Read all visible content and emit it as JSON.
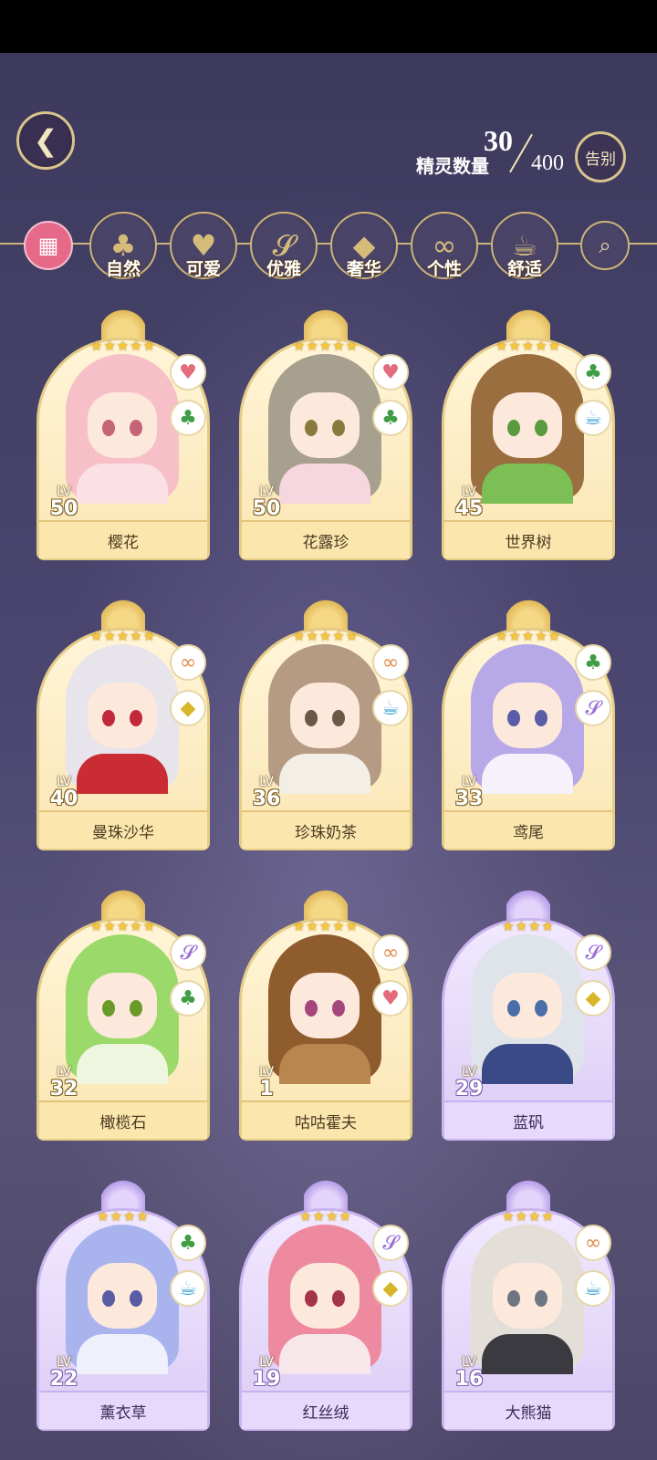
{
  "header": {
    "back_icon": "back-arrow-icon",
    "count_current": "30",
    "count_max": "400",
    "count_label": "精灵数量",
    "farewell_label": "告别"
  },
  "tabs": [
    {
      "label": "",
      "icon": "grid-icon"
    },
    {
      "label": "自然",
      "icon": "clover-icon"
    },
    {
      "label": "可爱",
      "icon": "heart-icon"
    },
    {
      "label": "优雅",
      "icon": "swan-icon"
    },
    {
      "label": "奢华",
      "icon": "diamond-icon"
    },
    {
      "label": "个性",
      "icon": "glasses-icon"
    },
    {
      "label": "舒适",
      "icon": "teacup-icon"
    },
    {
      "label": "",
      "icon": "search-icon"
    }
  ],
  "cards": [
    {
      "name": "樱花",
      "lv_label": "LV",
      "level": "50",
      "stars": "★★★★★",
      "badges": [
        "heart",
        "clover"
      ],
      "frame": "gold",
      "hair": "#f7c0c8",
      "eye": "#c46575",
      "outfit": "#fbe1e6"
    },
    {
      "name": "花露珍",
      "lv_label": "LV",
      "level": "50",
      "stars": "★★★★★",
      "badges": [
        "heart",
        "clover"
      ],
      "frame": "gold",
      "hair": "#a8a08e",
      "eye": "#8b7a3e",
      "outfit": "#f6d6df"
    },
    {
      "name": "世界树",
      "lv_label": "LV",
      "level": "45",
      "stars": "★★★★★",
      "badges": [
        "clover",
        "tea"
      ],
      "frame": "gold",
      "hair": "#9b6e3f",
      "eye": "#5b9a3e",
      "outfit": "#7bbf55"
    },
    {
      "name": "曼珠沙华",
      "lv_label": "LV",
      "level": "40",
      "stars": "★★★★★",
      "badges": [
        "glasses",
        "diamond"
      ],
      "frame": "gold",
      "hair": "#e8e4ec",
      "eye": "#c2283c",
      "outfit": "#c92c33"
    },
    {
      "name": "珍珠奶茶",
      "lv_label": "LV",
      "level": "36",
      "stars": "★★★★★",
      "badges": [
        "glasses",
        "tea"
      ],
      "frame": "gold",
      "hair": "#b59b83",
      "eye": "#6b5845",
      "outfit": "#f4efe6"
    },
    {
      "name": "鸢尾",
      "lv_label": "LV",
      "level": "33",
      "stars": "★★★★★",
      "badges": [
        "clover",
        "swan"
      ],
      "frame": "gold",
      "hair": "#b7a8e8",
      "eye": "#5b5ca8",
      "outfit": "#f5f2fb"
    },
    {
      "name": "橄榄石",
      "lv_label": "LV",
      "level": "32",
      "stars": "★★★★★",
      "badges": [
        "swan",
        "clover"
      ],
      "frame": "gold",
      "hair": "#9bd96b",
      "eye": "#6a9a2a",
      "outfit": "#eef6e0"
    },
    {
      "name": "咕咕霍夫",
      "lv_label": "LV",
      "level": "1",
      "stars": "★★★★★",
      "badges": [
        "glasses",
        "heart"
      ],
      "frame": "gold",
      "hair": "#8f5c2e",
      "eye": "#a4477c",
      "outfit": "#b8864e"
    },
    {
      "name": "蓝矾",
      "lv_label": "LV",
      "level": "29",
      "stars": "★★★★",
      "badges": [
        "swan",
        "diamond"
      ],
      "frame": "purple",
      "hair": "#dfe3ea",
      "eye": "#4a6ea8",
      "outfit": "#3a4a86"
    },
    {
      "name": "薰衣草",
      "lv_label": "LV",
      "level": "22",
      "stars": "★★★★",
      "badges": [
        "clover",
        "tea"
      ],
      "frame": "purple",
      "hair": "#a9b4ee",
      "eye": "#5a5ca6",
      "outfit": "#eef0fb"
    },
    {
      "name": "红丝绒",
      "lv_label": "LV",
      "level": "19",
      "stars": "★★★★",
      "badges": [
        "swan",
        "diamond"
      ],
      "frame": "purple",
      "hair": "#ee8aa0",
      "eye": "#a33548",
      "outfit": "#f7e7ea"
    },
    {
      "name": "大熊猫",
      "lv_label": "LV",
      "level": "16",
      "stars": "★★★★",
      "badges": [
        "glasses",
        "tea"
      ],
      "frame": "purple",
      "hair": "#e3dfd8",
      "eye": "#6d7682",
      "outfit": "#3b3a40"
    }
  ]
}
